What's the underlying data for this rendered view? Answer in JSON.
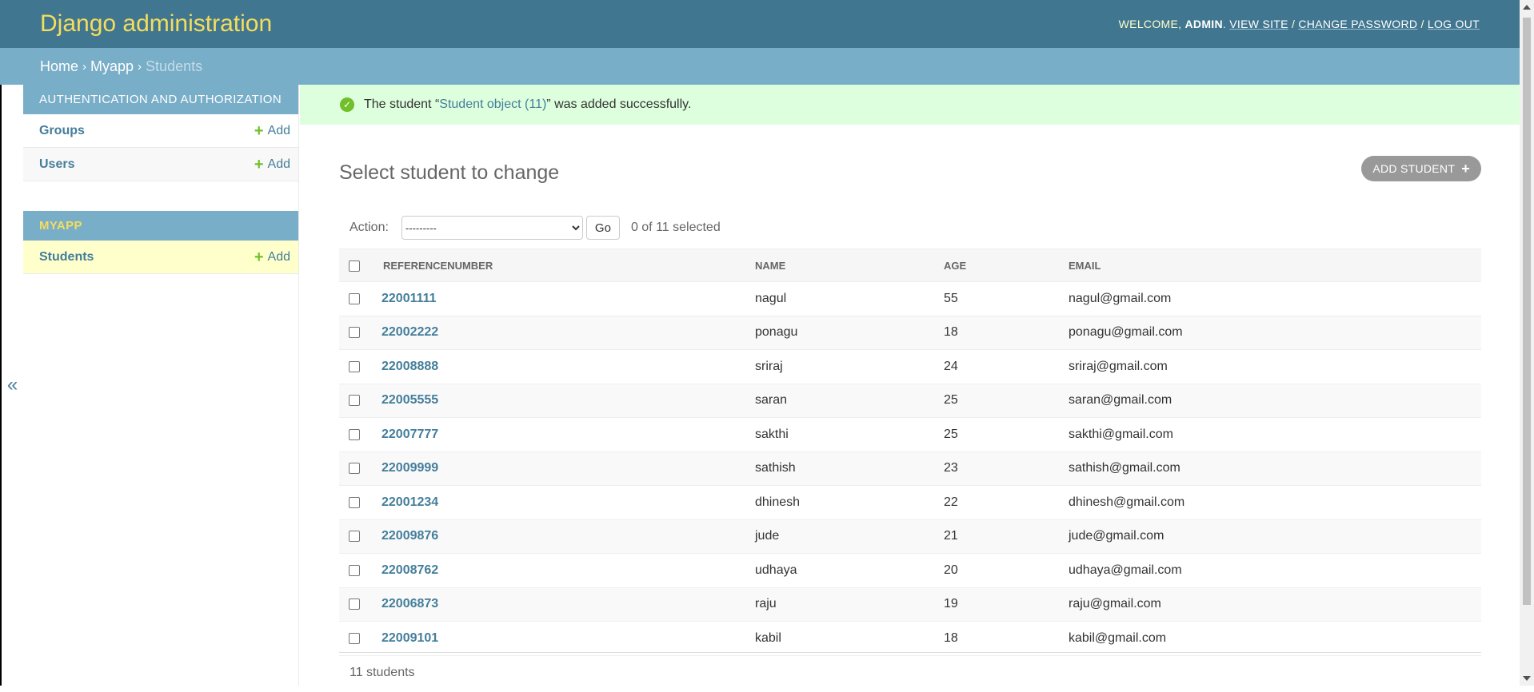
{
  "header": {
    "branding": "Django administration",
    "welcome": "Welcome,",
    "username": "admin",
    "view_site": "View site",
    "change_password": "Change password",
    "log_out": "Log out"
  },
  "breadcrumbs": [
    "Home",
    "Myapp",
    "Students"
  ],
  "nav_toggle": "«",
  "sidebar": {
    "auth_caption": "Authentication and Authorization",
    "auth_items": [
      {
        "label": "Groups",
        "add": "Add"
      },
      {
        "label": "Users",
        "add": "Add"
      }
    ],
    "myapp_caption": "Myapp",
    "myapp_items": [
      {
        "label": "Students",
        "add": "Add"
      }
    ]
  },
  "message": {
    "prefix": "The student “",
    "link": "Student object (11)",
    "suffix": "” was added successfully."
  },
  "title": "Select student to change",
  "add_button": "Add student",
  "actions": {
    "label": "Action:",
    "select_value": "---------",
    "go": "Go",
    "counter": "0 of 11 selected"
  },
  "table": {
    "headers": [
      "Referencenumber",
      "Name",
      "Age",
      "Email"
    ],
    "rows": [
      {
        "ref": "22001111",
        "name": "nagul",
        "age": "55",
        "email": "nagul@gmail.com"
      },
      {
        "ref": "22002222",
        "name": "ponagu",
        "age": "18",
        "email": "ponagu@gmail.com"
      },
      {
        "ref": "22008888",
        "name": "sriraj",
        "age": "24",
        "email": "sriraj@gmail.com"
      },
      {
        "ref": "22005555",
        "name": "saran",
        "age": "25",
        "email": "saran@gmail.com"
      },
      {
        "ref": "22007777",
        "name": "sakthi",
        "age": "25",
        "email": "sakthi@gmail.com"
      },
      {
        "ref": "22009999",
        "name": "sathish",
        "age": "23",
        "email": "sathish@gmail.com"
      },
      {
        "ref": "22001234",
        "name": "dhinesh",
        "age": "22",
        "email": "dhinesh@gmail.com"
      },
      {
        "ref": "22009876",
        "name": "jude",
        "age": "21",
        "email": "jude@gmail.com"
      },
      {
        "ref": "22008762",
        "name": "udhaya",
        "age": "20",
        "email": "udhaya@gmail.com"
      },
      {
        "ref": "22006873",
        "name": "raju",
        "age": "19",
        "email": "raju@gmail.com"
      },
      {
        "ref": "22009101",
        "name": "kabil",
        "age": "18",
        "email": "kabil@gmail.com"
      }
    ]
  },
  "paginator": "11 students"
}
